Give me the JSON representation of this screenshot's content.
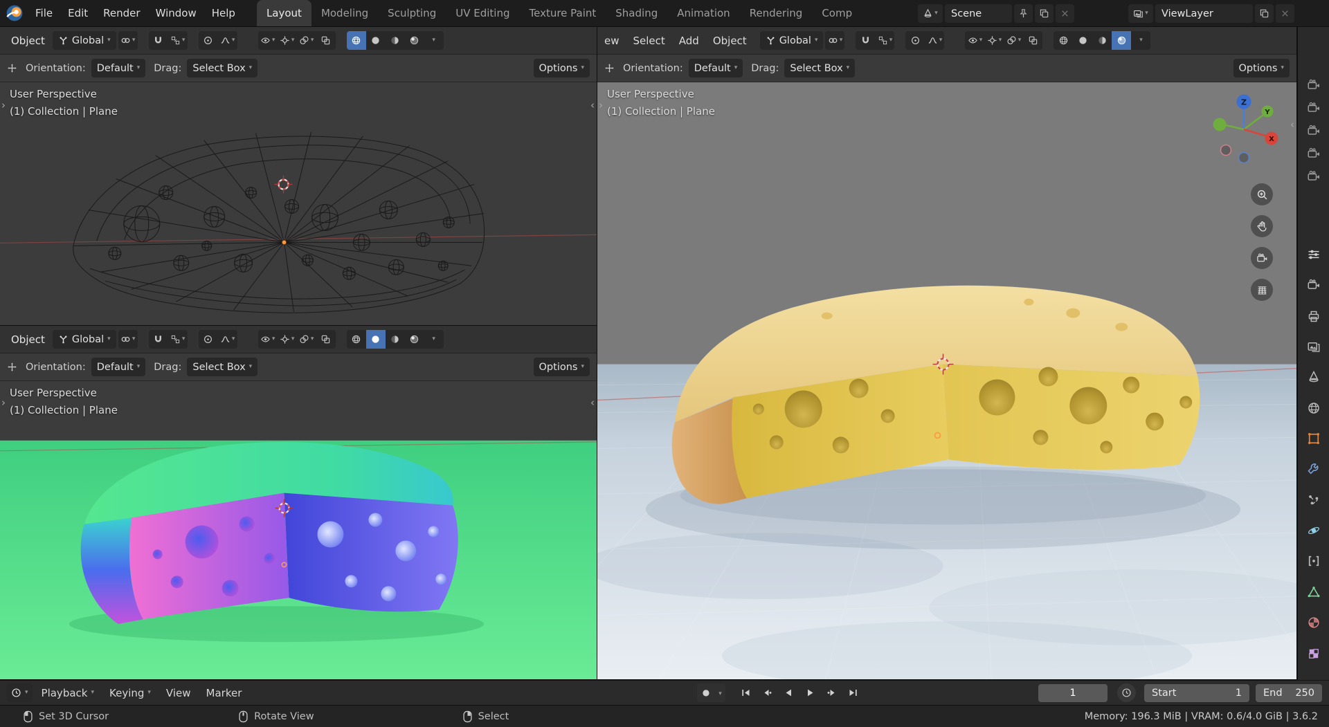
{
  "topbar": {
    "menus": [
      "File",
      "Edit",
      "Render",
      "Window",
      "Help"
    ],
    "workspaces": [
      "Layout",
      "Modeling",
      "Sculpting",
      "UV Editing",
      "Texture Paint",
      "Shading",
      "Animation",
      "Rendering",
      "Comp"
    ],
    "scene": "Scene",
    "viewlayer": "ViewLayer"
  },
  "shared": {
    "transform_orientation": "Global",
    "orientation_label": "Orientation:",
    "orientation_value": "Default",
    "drag_label": "Drag:",
    "drag_value": "Select Box",
    "options_label": "Options",
    "overlay_line1": "User Perspective",
    "overlay_line2": "(1) Collection | Plane"
  },
  "viewports": {
    "top_left": {
      "mode": "Object"
    },
    "bottom_left": {
      "mode": "Object"
    },
    "right": {
      "menus": [
        "ew",
        "Select",
        "Add",
        "Object"
      ]
    }
  },
  "gizmo": {
    "x": "X",
    "y": "Y",
    "z": "Z"
  },
  "timeline": {
    "playback": "Playback",
    "keying": "Keying",
    "view": "View",
    "marker": "Marker",
    "current_frame": "1",
    "start_label": "Start",
    "start_value": "1",
    "end_label": "End",
    "end_value": "250"
  },
  "statusbar": {
    "lmb": "Set 3D Cursor",
    "mmb": "Rotate View",
    "rmb": "Select",
    "stats": "Memory: 196.3 MiB | VRAM: 0.6/4.0 GiB | 3.6.2"
  },
  "colors": {
    "accent": "#4772b3",
    "cheese_yellow": "#e2c554",
    "rind_orange": "#d8a667",
    "floor_blue": "#d7e0e9",
    "floor_green": "#50e08c",
    "normal_pink_face": "#e468d4",
    "normal_blue_face": "#5a5ae8",
    "axis_x": "#d8453a",
    "axis_y": "#6fae3e",
    "axis_z": "#3b6fd1"
  }
}
